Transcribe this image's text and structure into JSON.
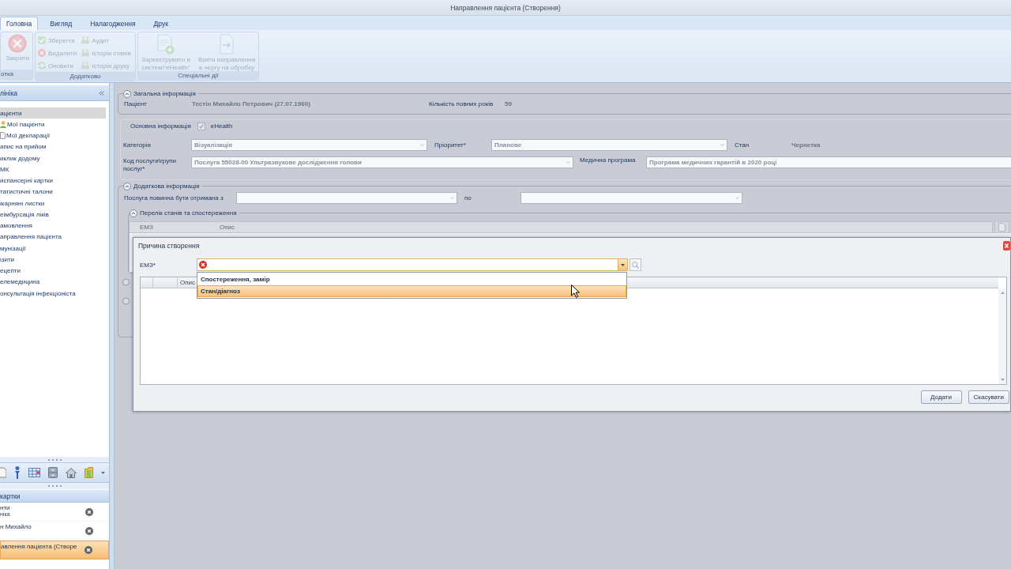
{
  "window": {
    "title": "Направлення пацієнта (Створення)"
  },
  "ribbon": {
    "tabs": [
      {
        "label": "Головна",
        "selected": true
      },
      {
        "label": "Вигляд",
        "selected": false
      },
      {
        "label": "Налагодження",
        "selected": false
      },
      {
        "label": "Друк",
        "selected": false
      }
    ],
    "groups": [
      {
        "label": "отка",
        "kind": "large",
        "buttons": [
          {
            "label": "Закрити",
            "disabled": true
          }
        ]
      },
      {
        "label": "Додатково",
        "kind": "small",
        "buttons": [
          {
            "label": "Зберегти",
            "disabled": true
          },
          {
            "label": "Видалити",
            "disabled": true
          },
          {
            "label": "Оновити",
            "disabled": true
          },
          {
            "label": "Аудит",
            "disabled": true
          },
          {
            "label": "Історія станів",
            "disabled": true
          },
          {
            "label": "Історія друку",
            "disabled": true
          }
        ]
      },
      {
        "label": "Спеціальні дії",
        "kind": "large",
        "buttons": [
          {
            "label": "Зареєструвати в системі\"eHealth\"",
            "disabled": true
          },
          {
            "label": "Взяти направлення в чергу на обробку",
            "disabled": true
          }
        ]
      }
    ]
  },
  "sidebar": {
    "title": "лініка",
    "items": [
      {
        "label": "ацієнти",
        "selected": true,
        "children": [
          {
            "label": "Мої пацієнти",
            "selected": false
          },
          {
            "label": "Мої декларації",
            "selected": false
          }
        ]
      },
      {
        "label": "апис на прийом",
        "selected": false
      },
      {
        "label": "иклик додому",
        "selected": false
      },
      {
        "label": "МК",
        "selected": false
      },
      {
        "label": "испансерні картки",
        "selected": false
      },
      {
        "label": "татистичні талони",
        "selected": false
      },
      {
        "label": "ікарняні листки",
        "selected": false
      },
      {
        "label": "еімбурсація ліків",
        "selected": false
      },
      {
        "label": "амовлення",
        "selected": false
      },
      {
        "label": "аправлення пацієнта",
        "selected": false
      },
      {
        "label": "мунізації",
        "selected": false
      },
      {
        "label": "ізити",
        "selected": false
      },
      {
        "label": "ецепти",
        "selected": false
      },
      {
        "label": "елемедицина",
        "selected": false
      },
      {
        "label": "онсультація інфекціоніста",
        "selected": false
      }
    ]
  },
  "open_windows": {
    "title": "картки",
    "items": [
      {
        "label": "нти",
        "sublabel": "ніка",
        "selected": false
      },
      {
        "label": "н Михайло",
        "selected": false
      },
      {
        "label": "авлення пацієнта (Створе",
        "selected": true
      }
    ]
  },
  "general": {
    "title": "Загальна інформація",
    "patient_label": "Пацієнт",
    "patient": "Тестін Михайло Петрович (27.07.1960)",
    "age_label": "Кількість повних років",
    "age": "59"
  },
  "main_info": {
    "title": "Основна інформація",
    "ehealth": {
      "label": "eHealth",
      "checked": true,
      "disabled": true
    },
    "rows": [
      [
        {
          "kind": "combo",
          "label": "Категорія",
          "value": "Візуалізація",
          "disabled": true
        },
        {
          "kind": "combo",
          "label": "Пріоритет*",
          "value": "Планове",
          "disabled": true
        },
        {
          "kind": "readout",
          "label": "Стан",
          "value": "Чернетка"
        }
      ],
      [
        {
          "kind": "combo",
          "label": "Код послуги\\групи послуг*",
          "value": "Послуга 55028-00 Ультразвукове дослідження голови",
          "disabled": true
        },
        {
          "kind": "text",
          "label": "Медична програма",
          "value": "Програма медичних гарантій в 2020 році",
          "disabled": true
        }
      ]
    ]
  },
  "additional": {
    "title": "Додаткова інформація",
    "fields": [
      {
        "kind": "combo",
        "label": "Послуга повинна бути отримана з"
      },
      {
        "kind": "combo",
        "label": "по"
      }
    ]
  },
  "conditions": {
    "title": "Перелік станів та спостереження",
    "columns": [
      "ЕМЗ",
      "Опис"
    ]
  },
  "dialog": {
    "title": "Причина створення",
    "emz": {
      "label": "ЕМЗ*",
      "invalid": true,
      "options": [
        {
          "label": "Спостереження, замір",
          "selected": false
        },
        {
          "label": "Стан/діагноз",
          "selected": true
        }
      ]
    },
    "search_button": {
      "disabled": true
    },
    "grid": {
      "columns": [
        "Опис"
      ]
    },
    "buttons": [
      "Додати",
      "Скасувати"
    ]
  }
}
